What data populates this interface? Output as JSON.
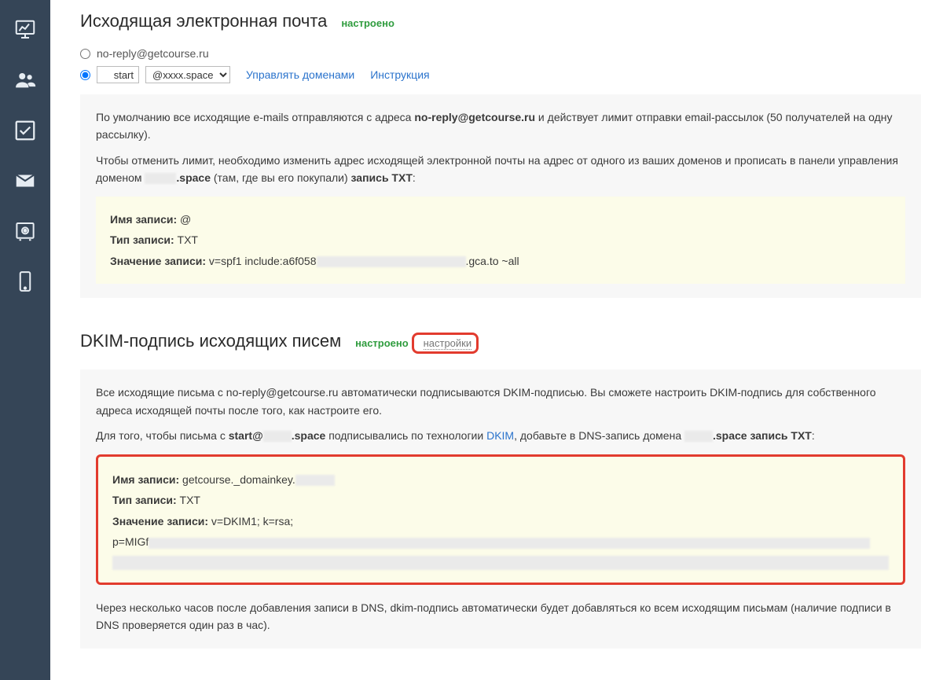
{
  "sidebar": {
    "items": [
      {
        "name": "analytics"
      },
      {
        "name": "community"
      },
      {
        "name": "tasks"
      },
      {
        "name": "mail"
      },
      {
        "name": "settings"
      },
      {
        "name": "mobile"
      }
    ]
  },
  "outgoing": {
    "title": "Исходящая электронная почта",
    "status": "настроено",
    "radio_noreply": "no-reply@getcourse.ru",
    "custom_local": "start",
    "custom_domain_visible": "@xxxx.space",
    "manage_domains": "Управлять доменами",
    "instructions": "Инструкция",
    "info_p1_prefix": "По умолчанию все исходящие e-mails отправляются с адреса ",
    "info_p1_bold": "no-reply@getcourse.ru",
    "info_p1_suffix": " и действует лимит отправки email-рассылок (50 получателей на одну рассылку).",
    "info_p2_prefix": "Чтобы отменить лимит, необходимо изменить адрес исходящей электронной почты на адрес от одного из ваших доменов   и прописать в панели управления доменом ",
    "info_p2_domainfrag": ".space",
    "info_p2_mid": " (там, где вы его покупали) ",
    "info_p2_bold": "запись TXT",
    "record": {
      "name_label": "Имя записи:",
      "name_value": "@",
      "type_label": "Тип записи:",
      "type_value": "TXT",
      "value_label": "Значение записи:",
      "value_prefix": "v=spf1 include:a6f058",
      "value_suffix": ".gca.to ~all"
    }
  },
  "dkim": {
    "title": "DKIM-подпись исходящих писем",
    "status": "настроено",
    "settings_link": "настройки",
    "info_p1": "Все исходящие письма с no-reply@getcourse.ru автоматически подписываются DKIM-подписью. Вы сможете настроить DKIM-подпись для собственного адреса исходящей почты после того, как настроите его.",
    "info_p2_prefix": "Для того, чтобы письма с ",
    "info_p2_bold1": "start@",
    "info_p2_domainfrag": ".space",
    "info_p2_mid": " подписывались по технологии ",
    "info_p2_link": "DKIM",
    "info_p2_mid2": ", добавьте в DNS-запись домена ",
    "info_p2_domainfrag2": ".space",
    "info_p2_bold2": " запись TXT",
    "record": {
      "name_label": "Имя записи:",
      "name_value": "getcourse._domainkey.",
      "type_label": "Тип записи:",
      "type_value": "TXT",
      "value_label": "Значение записи:",
      "value_line1": "v=DKIM1; k=rsa;",
      "value_line2_prefix": "p=MIGf"
    },
    "below_note": "Через несколько часов после добавления записи в DNS, dkim-подпись автоматически будет добавляться ко всем исходящим письмам (наличие подписи в DNS проверяется один раз в час)."
  }
}
